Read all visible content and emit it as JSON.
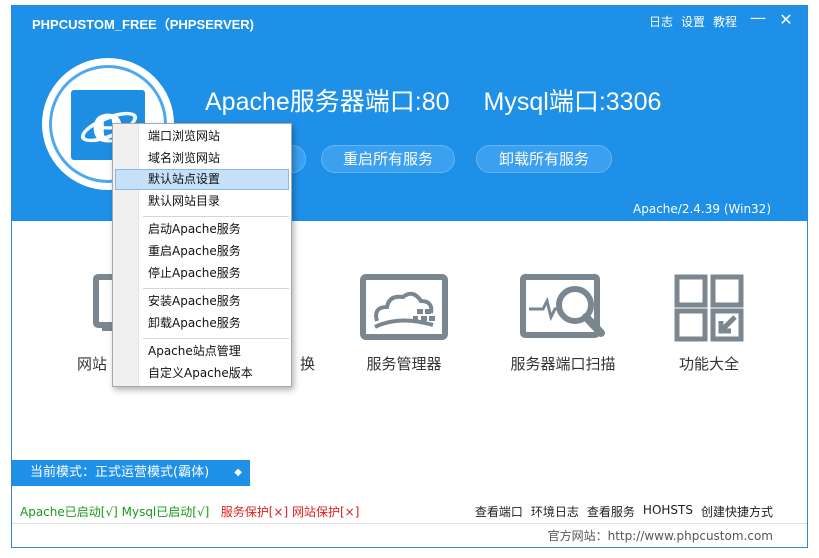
{
  "window": {
    "title": "PHPCUSTOM_FREE（PHPSERVER)",
    "top_links": [
      "日志",
      "设置",
      "教程"
    ],
    "minimize": "—",
    "close": "✕"
  },
  "header": {
    "apache_port": "Apache服务器端口:80",
    "mysql_port": "Mysql端口:3306",
    "buttons": [
      "",
      "重启所有服务",
      "卸载所有服务"
    ],
    "version": "Apache/2.4.39 (Win32)"
  },
  "tools": {
    "items": [
      "网站",
      "换",
      "服务管理器",
      "服务器端口扫描",
      "功能大全"
    ]
  },
  "mode": {
    "label": "当前模式：正式运营模式(霸体)",
    "arrow": "◆"
  },
  "status": {
    "apache": "Apache已启动[√]",
    "mysql": "Mysql已启动[√]",
    "service_protect": "服务保护[×]",
    "site_protect": "网站保护[×]",
    "links": [
      "查看端口",
      "环境日志",
      "查看服务",
      "HOHSTS",
      "创建快捷方式"
    ]
  },
  "footer": {
    "official": "官方网站：http://www.phpcustom.com"
  },
  "context_menu": {
    "highlighted": 2,
    "items": [
      "端口浏览网站",
      "域名浏览网站",
      "默认站点设置",
      "默认网站目录",
      "启动Apache服务",
      "重启Apache服务",
      "停止Apache服务",
      "安装Apache服务",
      "卸载Apache服务",
      "Apache站点管理",
      "自定义Apache版本"
    ]
  },
  "colors": {
    "accent": "#1e90e8",
    "green": "#1a9a1a",
    "red": "#e02020"
  }
}
